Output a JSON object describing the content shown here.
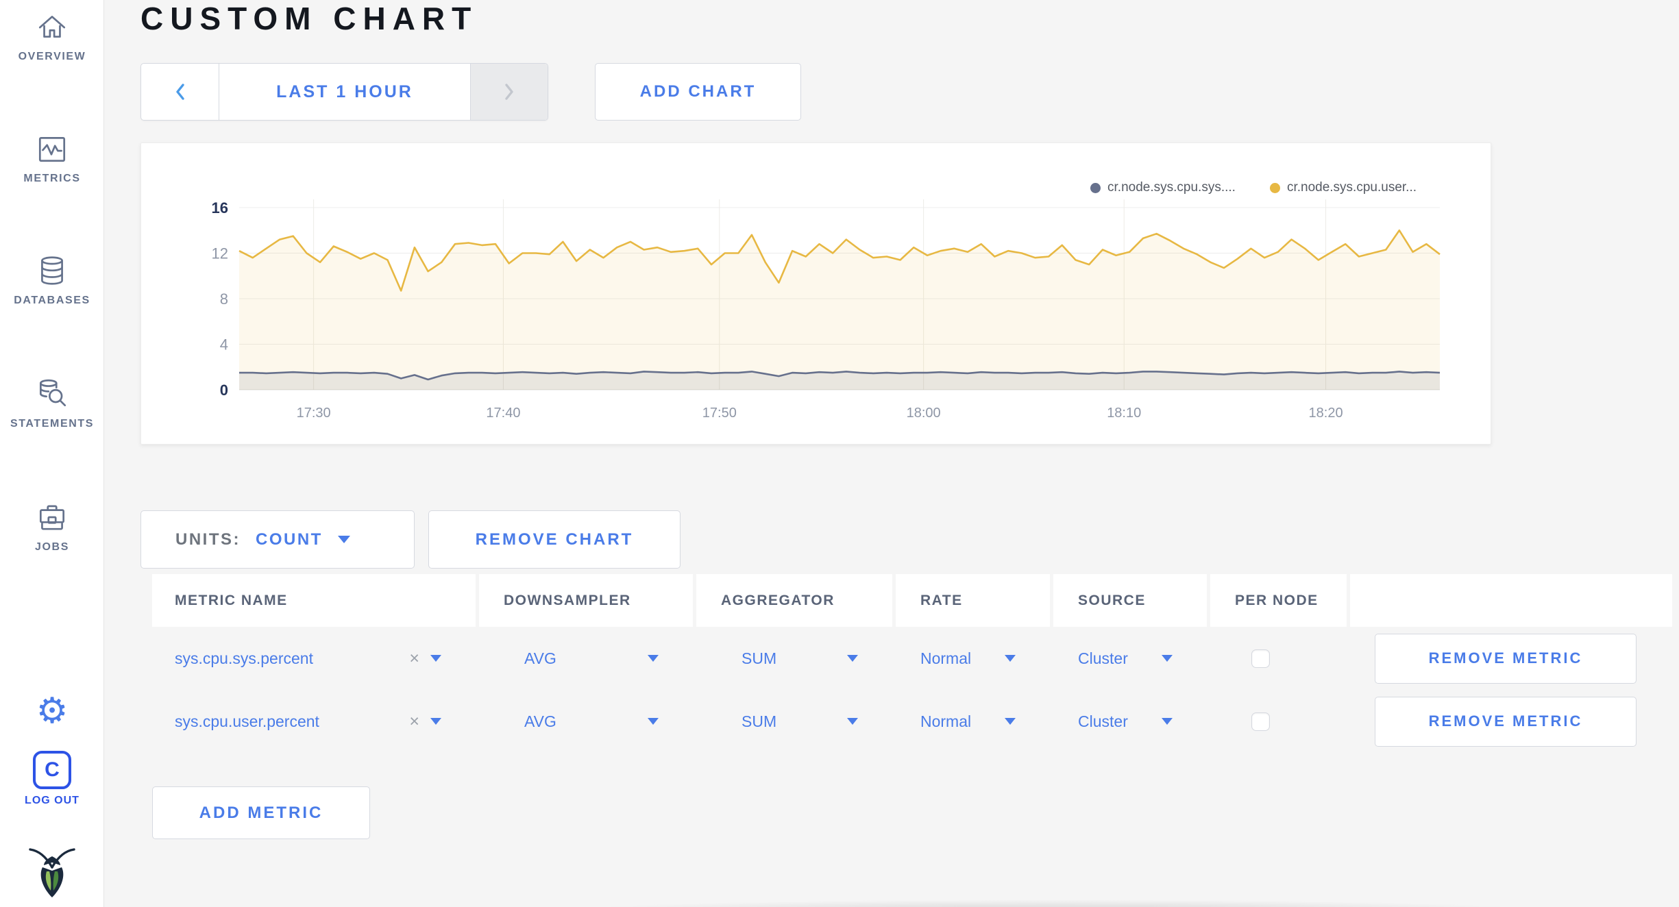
{
  "colors": {
    "accent": "#4A7CE8",
    "logout_blue": "#2D53E6",
    "sidebar_text": "#65728C",
    "title_text": "#14181F",
    "series_sys": "#66708C",
    "series_user": "#E7B843"
  },
  "sidebar": {
    "items": [
      {
        "icon": "home-icon",
        "label": "OVERVIEW"
      },
      {
        "icon": "metrics-icon",
        "label": "METRICS"
      },
      {
        "icon": "databases-icon",
        "label": "DATABASES"
      },
      {
        "icon": "statements-icon",
        "label": "STATEMENTS"
      },
      {
        "icon": "jobs-icon",
        "label": "JOBS"
      }
    ],
    "gear_glyph": "⚙",
    "logout": {
      "box_letter": "C",
      "label": "LOG OUT"
    }
  },
  "header": {
    "title": "CUSTOM CHART"
  },
  "toolbar": {
    "prev": "‹",
    "time_range": "LAST 1 HOUR",
    "next": "›",
    "add_chart": "ADD CHART"
  },
  "chart": {
    "legend": [
      {
        "label": "cr.node.sys.cpu.sys....",
        "color": "#66708C"
      },
      {
        "label": "cr.node.sys.cpu.user...",
        "color": "#E7B843"
      }
    ]
  },
  "chart_data": {
    "type": "line",
    "title": "",
    "xlabel": "",
    "ylabel": "",
    "ylim": [
      0,
      16
    ],
    "y_ticks": [
      0,
      4,
      8,
      12,
      16
    ],
    "x_ticks": [
      "17:30",
      "17:40",
      "17:50",
      "18:00",
      "18:10",
      "18:20"
    ],
    "tick_fracs": [
      0.062,
      0.22,
      0.4,
      0.57,
      0.737,
      0.905
    ],
    "grid": true,
    "legend_position": "top-right",
    "series": [
      {
        "name": "cr.node.sys.cpu.sys....",
        "color": "#66708C",
        "fill": "rgba(102,112,140,0.13)",
        "values": [
          1.5,
          1.5,
          1.45,
          1.5,
          1.55,
          1.5,
          1.45,
          1.5,
          1.5,
          1.45,
          1.5,
          1.4,
          1.0,
          1.3,
          0.9,
          1.25,
          1.45,
          1.5,
          1.5,
          1.45,
          1.5,
          1.55,
          1.5,
          1.45,
          1.5,
          1.4,
          1.5,
          1.55,
          1.5,
          1.45,
          1.6,
          1.55,
          1.5,
          1.5,
          1.55,
          1.45,
          1.5,
          1.5,
          1.6,
          1.4,
          1.2,
          1.5,
          1.45,
          1.55,
          1.5,
          1.6,
          1.5,
          1.45,
          1.5,
          1.45,
          1.5,
          1.5,
          1.55,
          1.5,
          1.45,
          1.55,
          1.5,
          1.5,
          1.45,
          1.5,
          1.5,
          1.55,
          1.45,
          1.4,
          1.5,
          1.45,
          1.5,
          1.6,
          1.6,
          1.55,
          1.5,
          1.45,
          1.4,
          1.35,
          1.45,
          1.5,
          1.45,
          1.5,
          1.55,
          1.5,
          1.45,
          1.5,
          1.55,
          1.45,
          1.5,
          1.5,
          1.6,
          1.5,
          1.55,
          1.5
        ]
      },
      {
        "name": "cr.node.sys.cpu.user...",
        "color": "#E7B843",
        "fill": "rgba(231,184,67,0.10)",
        "values": [
          12.2,
          11.6,
          12.4,
          13.2,
          13.5,
          12.0,
          11.2,
          12.6,
          12.1,
          11.5,
          12.0,
          11.4,
          8.7,
          12.5,
          10.4,
          11.2,
          12.8,
          12.9,
          12.7,
          12.8,
          11.1,
          12.0,
          12.0,
          11.9,
          13.0,
          11.3,
          12.3,
          11.6,
          12.5,
          13.0,
          12.3,
          12.5,
          12.1,
          12.2,
          12.4,
          11.0,
          12.0,
          12.0,
          13.6,
          11.2,
          9.4,
          12.2,
          11.7,
          12.8,
          12.0,
          13.2,
          12.3,
          11.6,
          11.7,
          11.4,
          12.5,
          11.8,
          12.2,
          12.4,
          12.1,
          12.8,
          11.7,
          12.2,
          12.0,
          11.6,
          11.7,
          12.7,
          11.4,
          11.0,
          12.3,
          11.8,
          12.1,
          13.3,
          13.7,
          13.1,
          12.4,
          11.9,
          11.2,
          10.7,
          11.5,
          12.4,
          11.6,
          12.1,
          13.2,
          12.4,
          11.4,
          12.1,
          12.8,
          11.7,
          12.0,
          12.3,
          14.0,
          12.1,
          12.8,
          11.9
        ]
      }
    ]
  },
  "controls": {
    "units_label": "UNITS:",
    "units_value": "COUNT",
    "remove_chart": "REMOVE CHART",
    "add_metric": "ADD METRIC",
    "remove_metric": "REMOVE METRIC",
    "clear_glyph": "×"
  },
  "table": {
    "columns": [
      "METRIC NAME",
      "DOWNSAMPLER",
      "AGGREGATOR",
      "RATE",
      "SOURCE",
      "PER NODE",
      ""
    ],
    "rows": [
      {
        "metric": "sys.cpu.sys.percent",
        "downsampler": "AVG",
        "aggregator": "SUM",
        "rate": "Normal",
        "source": "Cluster",
        "per_node": false
      },
      {
        "metric": "sys.cpu.user.percent",
        "downsampler": "AVG",
        "aggregator": "SUM",
        "rate": "Normal",
        "source": "Cluster",
        "per_node": false
      }
    ]
  }
}
